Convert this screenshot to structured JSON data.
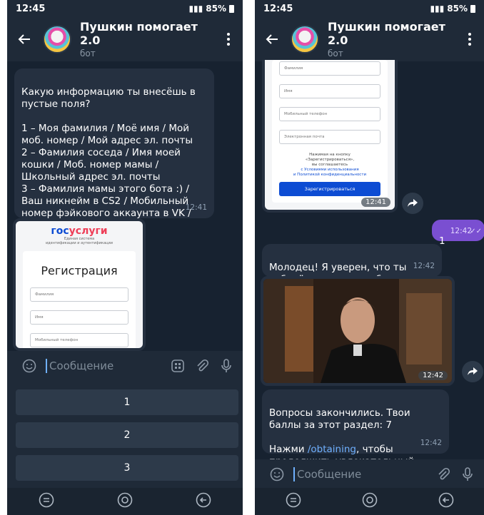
{
  "left": {
    "status": {
      "time": "12:45",
      "battery": "85%"
    },
    "header": {
      "title": "Пушкин помогает 2.0",
      "subtitle": "бот"
    },
    "question": {
      "text": "Какую информацию ты внесёшь в пустые поля?\n\n1 – Моя фамилия / Моё имя / Мой моб. номер / Мой адрес эл. почты\n2 – Фамилия соседа / Имя моей кошки / Моб. номер мамы / Школьный адрес эл. почты\n3 – Фамилия мамы этого бота :) / Ваш никнейм в CS2 / Мобильный номер фэйкового аккаунта в VK / Адрес эл.почты из Sims",
      "time": "12:41"
    },
    "form": {
      "logo_a": "гос",
      "logo_b": "услуги",
      "logo_sub": "Единая система\nидентификации и аутентификации",
      "title": "Регистрация",
      "fields": [
        "Фамилия",
        "Имя",
        "Мобильный телефон"
      ]
    },
    "input": {
      "placeholder": "Сообщение"
    },
    "keyboard": {
      "buttons": [
        "1",
        "2",
        "3"
      ]
    }
  },
  "right": {
    "status": {
      "time": "12:45",
      "battery": "85%"
    },
    "header": {
      "title": "Пушкин помогает 2.0",
      "subtitle": "бот"
    },
    "form": {
      "fields": [
        "Фамилия",
        "Имя",
        "Мобильный телефон",
        "Электронная почта"
      ],
      "note_1": "Нажимая на кнопку\n«Зарегистрироваться»,\nвы соглашаетесь",
      "note_link_1": "с Условиями использования",
      "note_link_2": "и Политикой конфиденциальности",
      "button": "Зарегистрироваться",
      "time": "12:41"
    },
    "reply": {
      "text": "1",
      "time": "12:42"
    },
    "praise": {
      "text": "Молодец! Я уверен, что ты соберёшь максимум баллов.",
      "time": "12:42"
    },
    "video": {
      "time": "12:42"
    },
    "result": {
      "line1": "Вопросы закончились. Твои баллы за этот раздел: 7",
      "line2_pre": " Нажми ",
      "command": "/obtaining",
      "line2_post": ", чтобы продолжить увлекательный квест!",
      "time": "12:42"
    },
    "input": {
      "placeholder": "Сообщение"
    }
  },
  "colors": {
    "background": "#172230",
    "bubble": "#253040",
    "outgoing": "#7a4fd1",
    "link": "#6fb0ff"
  },
  "icons": [
    "back-arrow",
    "more-vertical",
    "emoji",
    "bot-keyboard",
    "attach",
    "microphone",
    "share",
    "nav-menu",
    "nav-home",
    "nav-back"
  ]
}
